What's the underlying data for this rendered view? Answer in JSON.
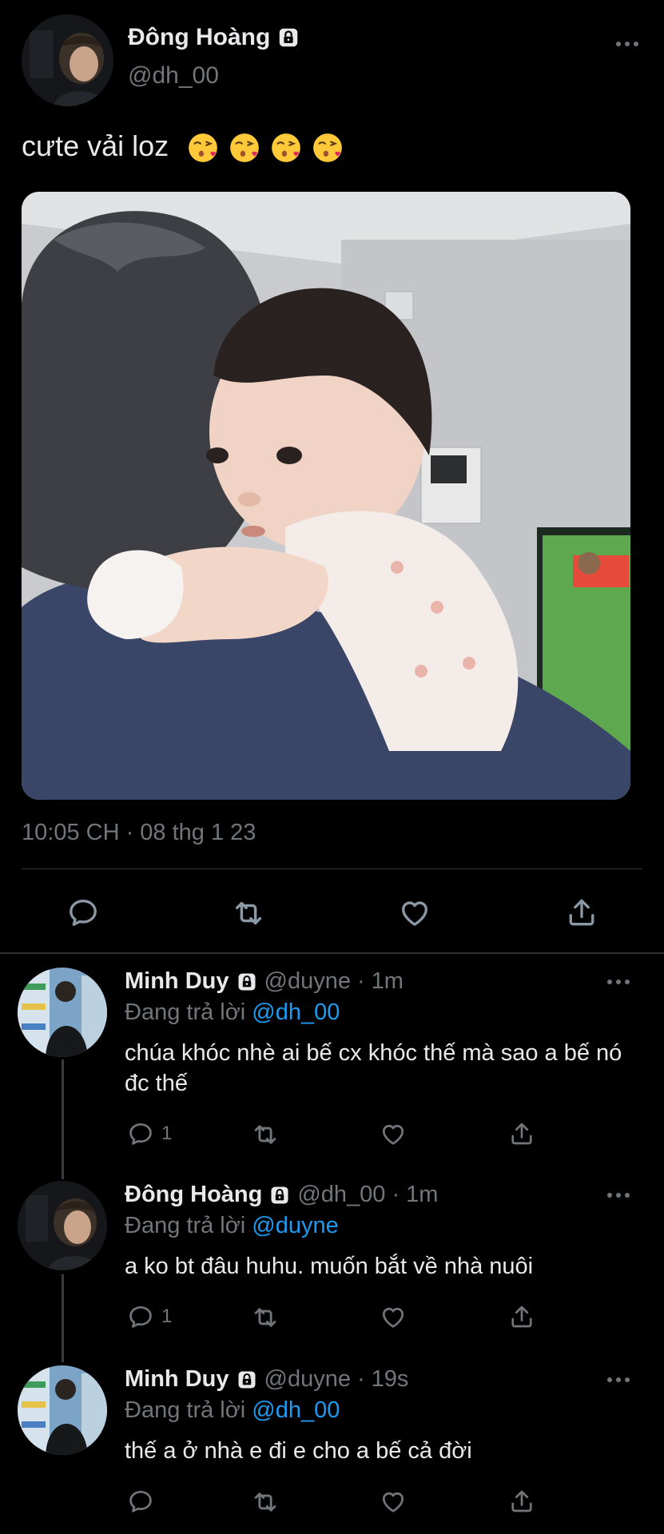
{
  "main_tweet": {
    "author_name": "Đông Hoàng",
    "author_handle": "@dh_00",
    "text": "cưte vải loz",
    "emoji_count": 4,
    "timestamp": "10:05 CH · 08 thg 1 23"
  },
  "replies": [
    {
      "author_name": "Minh Duy",
      "author_handle": "@duyne",
      "time": "· 1m",
      "replying_prefix": "Đang trả lời",
      "replying_to": "@dh_00",
      "text": "chúa khóc nhè ai bế cx khóc thế mà sao a bế nó đc thế",
      "reply_count": "1"
    },
    {
      "author_name": "Đông Hoàng",
      "author_handle": "@dh_00",
      "time": "· 1m",
      "replying_prefix": "Đang trả lời",
      "replying_to": "@duyne",
      "text": "a ko bt đâu huhu. muốn bắt về nhà nuôi",
      "reply_count": "1"
    },
    {
      "author_name": "Minh Duy",
      "author_handle": "@duyne",
      "time": "· 19s",
      "replying_prefix": "Đang trả lời",
      "replying_to": "@dh_00",
      "text": "thế a ở nhà e đi e cho a bế cả đời",
      "reply_count": ""
    }
  ],
  "icons": {
    "reply": "reply-icon",
    "retweet": "retweet-icon",
    "like": "like-icon",
    "share": "share-icon",
    "more": "more-icon",
    "lock": "lock-icon"
  },
  "colors": {
    "background": "#000000",
    "text": "#e7e9ea",
    "muted": "#71767b",
    "mention": "#1d9bf0",
    "divider": "#2f3336"
  }
}
